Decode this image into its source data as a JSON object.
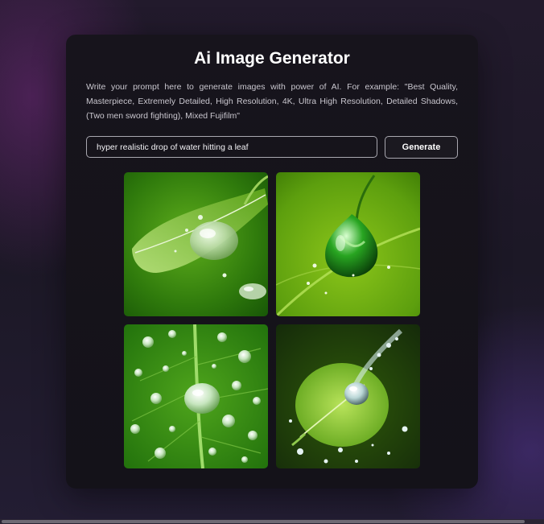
{
  "app": {
    "title": "Ai Image Generator",
    "description": "Write your prompt here to generate images with power of AI. For example: \"Best Quality, Masterpiece, Extremely Detailed, High Resolution, 4K, Ultra High Resolution, Detailed Shadows, (Two men sword fighting), Mixed Fujifilm\""
  },
  "prompt": {
    "value": "hyper realistic drop of water hitting a leaf"
  },
  "generate_button": {
    "label": "Generate"
  },
  "images": [
    {
      "icon": "water-drop-on-leaf-image"
    },
    {
      "icon": "green-drop-on-leaf-image"
    },
    {
      "icon": "water-droplets-on-leaf-image"
    },
    {
      "icon": "water-splash-on-leaf-image"
    }
  ],
  "colors": {
    "accent_green": "#4a9a12",
    "card_bg": "#16131b",
    "border": "#a9a8b0"
  }
}
